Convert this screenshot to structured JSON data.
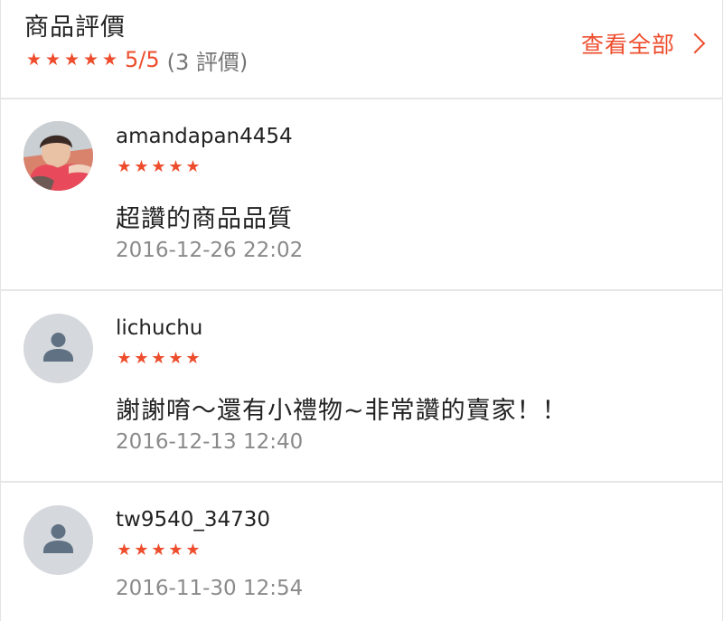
{
  "header": {
    "title": "商品評價",
    "star_icons": [
      "★",
      "★",
      "★",
      "★",
      "★"
    ],
    "score": "5/5",
    "count_text": "(3 評價)",
    "view_all_label": "查看全部"
  },
  "colors": {
    "accent": "#ee4d2d",
    "text": "#222222",
    "muted": "#8a8a8a",
    "divider": "#e6e6e6",
    "avatar_placeholder": "#d5d8dc",
    "avatar_icon": "#5f7183"
  },
  "reviews": [
    {
      "username": "amandapan4454",
      "avatar": "user-photo",
      "rating": 5,
      "stars": [
        "★",
        "★",
        "★",
        "★",
        "★"
      ],
      "comment": "超讚的商品品質",
      "timestamp": "2016-12-26 22:02"
    },
    {
      "username": "lichuchu",
      "avatar": "default-user-icon",
      "rating": 5,
      "stars": [
        "★",
        "★",
        "★",
        "★",
        "★"
      ],
      "comment": "謝謝唷～還有小禮物~非常讚的賣家！！",
      "timestamp": "2016-12-13 12:40"
    },
    {
      "username": "tw9540_34730",
      "avatar": "default-user-icon",
      "rating": 5,
      "stars": [
        "★",
        "★",
        "★",
        "★",
        "★"
      ],
      "comment": "",
      "timestamp": "2016-11-30 12:54"
    }
  ]
}
